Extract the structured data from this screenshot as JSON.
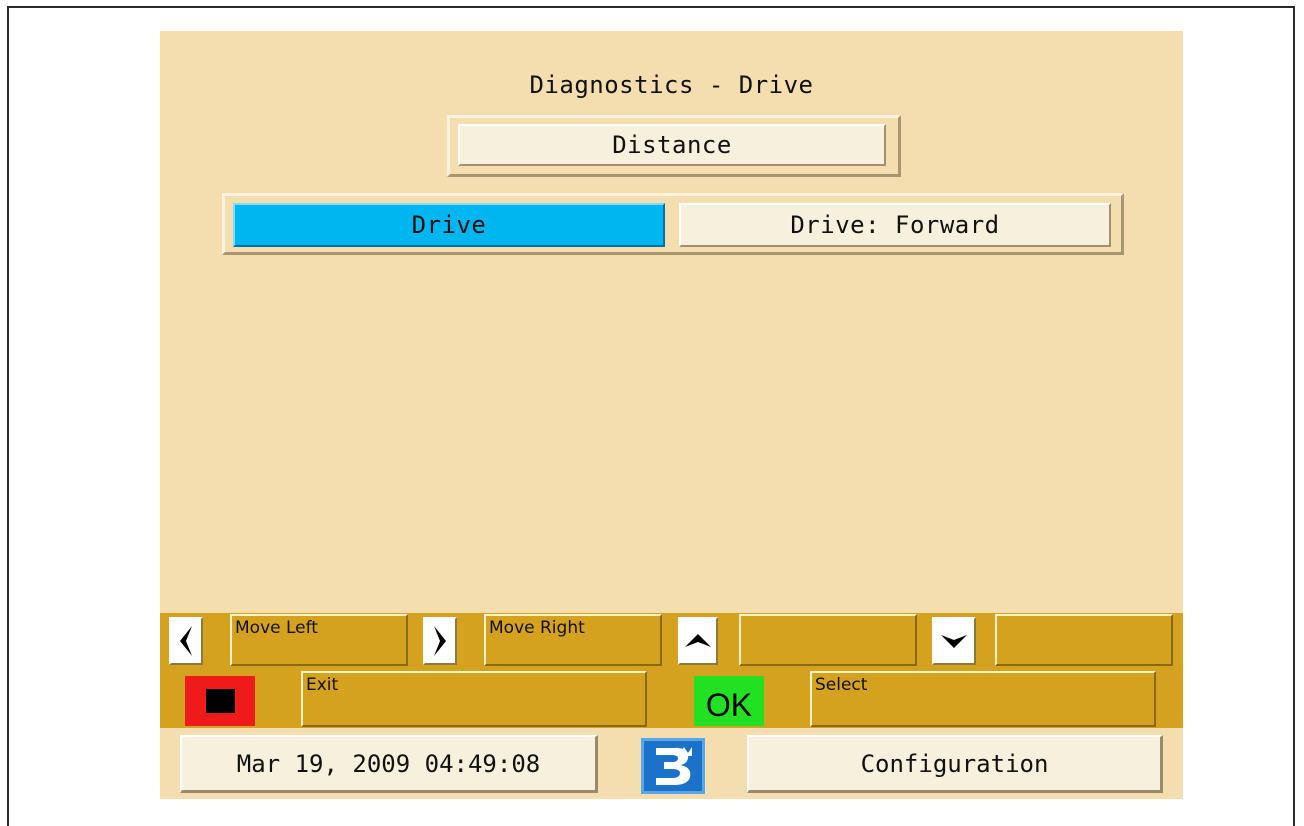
{
  "screen": {
    "title": "Diagnostics - Drive",
    "distance_label": "Distance",
    "drive_label": "Drive",
    "drive_value": "Drive: Forward"
  },
  "softkeys": {
    "left_label": "Move Left",
    "right_label": "Move Right",
    "up_label": "",
    "down_label": "",
    "exit_label": "Exit",
    "ok_label": "OK",
    "select_label": "Select"
  },
  "footer": {
    "datetime": "Mar 19, 2009 04:49:08",
    "config_label": "Configuration"
  },
  "colors": {
    "background": "#f4deb0",
    "softkey_bar": "#d4a21f",
    "selected": "#00b6f0",
    "stop": "#ef1a1a",
    "ok": "#22e022",
    "logo": "#1a73c9"
  },
  "icons": {
    "left": "arrow-left-icon",
    "right": "arrow-right-icon",
    "up": "arrow-up-icon",
    "down": "arrow-down-icon",
    "stop": "stop-icon",
    "logo": "brand-logo-icon"
  }
}
